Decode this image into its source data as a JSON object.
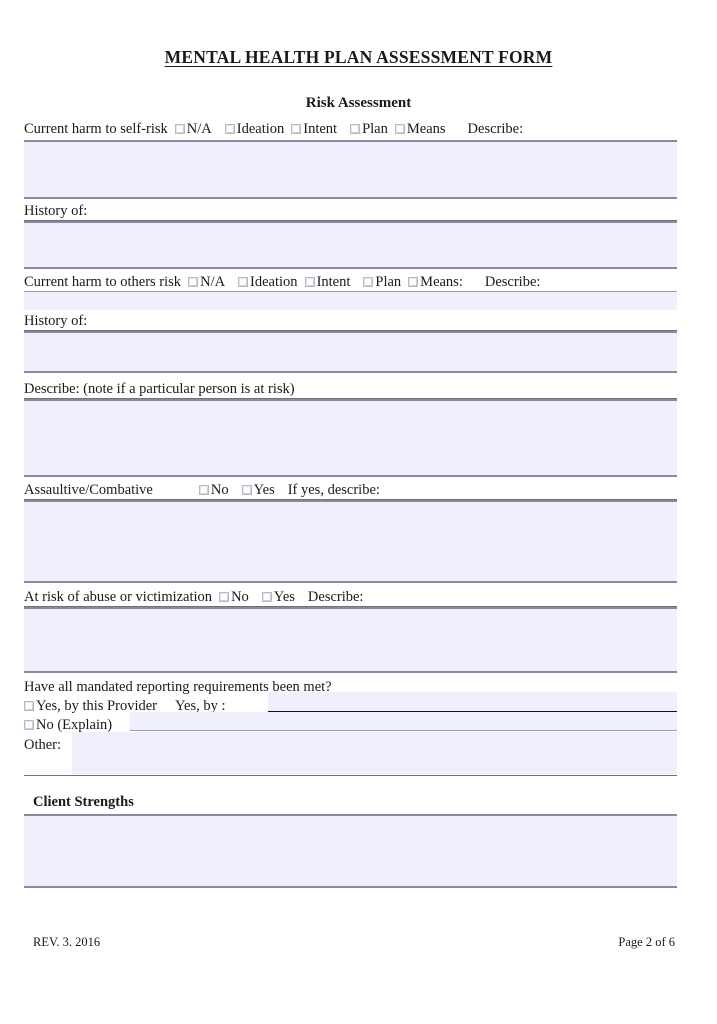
{
  "document": {
    "title": "MENTAL HEALTH PLAN ASSESSMENT FORM",
    "section_heading": "Risk Assessment"
  },
  "colors": {
    "field_fill": "#eff0fb",
    "rule": "#6f6f80",
    "text": "#1a1a1a"
  },
  "sections": {
    "self_risk": {
      "label": "Current harm to self-risk",
      "options": [
        "N/A",
        "Ideation",
        "Intent",
        "Plan",
        "Means"
      ],
      "describe_label": "Describe:",
      "history_label": "History of:"
    },
    "others_risk": {
      "label": "Current harm to others risk",
      "options": [
        "N/A",
        "Ideation",
        "Intent",
        "Plan",
        "Means:"
      ],
      "describe_label": "Describe:",
      "history_label": "History of:",
      "describe_note_label": "Describe: (note if a particular person is at risk)"
    },
    "assaultive": {
      "label": "Assaultive/Combative",
      "options": [
        "No",
        "Yes"
      ],
      "followup_label": "If yes, describe:"
    },
    "abuse_risk": {
      "label": "At risk of abuse or victimization",
      "options": [
        "No",
        "Yes"
      ],
      "followup_label": "Describe:"
    },
    "mandated_reporting": {
      "question": "Have all mandated reporting requirements been met?",
      "yes_provider_label": "Yes, by this Provider",
      "yes_by_label": "Yes, by :",
      "yes_by_value": "",
      "no_explain_label": "No (Explain)",
      "no_explain_value": "",
      "other_label": "Other:",
      "other_value": ""
    },
    "client_strengths": {
      "title": "Client Strengths",
      "value": ""
    }
  },
  "fields": {
    "self_risk_describe": "",
    "self_risk_history": "",
    "others_risk_describe": "",
    "others_risk_history": "",
    "others_risk_person_note": "",
    "assaultive_describe": "",
    "abuse_describe": ""
  },
  "footer": {
    "revision": "REV. 3. 2016",
    "page": "Page 2 of 6"
  }
}
